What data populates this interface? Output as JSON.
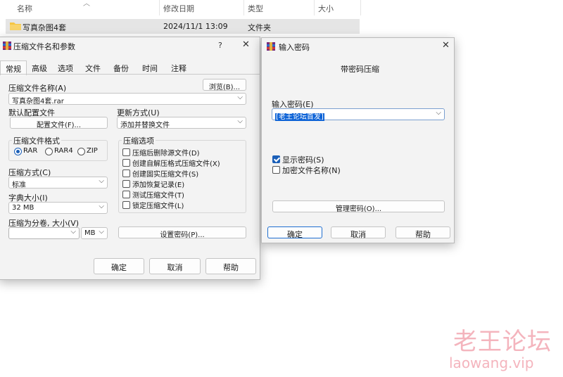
{
  "explorer": {
    "columns": [
      "名称",
      "修改日期",
      "类型",
      "大小"
    ],
    "file": {
      "name": "写真杂图4套",
      "date": "2024/11/1 13:09",
      "type": "文件夹"
    }
  },
  "archive_dialog": {
    "title": "压缩文件名和参数",
    "help_glyph": "?",
    "close_glyph": "✕",
    "tabs": [
      "常规",
      "高级",
      "选项",
      "文件",
      "备份",
      "时间",
      "注释"
    ],
    "archive_name_label": "压缩文件名称(A)",
    "archive_name_value": "写真杂图4套.rar",
    "browse_label": "浏览(B)...",
    "default_profile_label": "默认配置文件",
    "profile_button": "配置文件(F)...",
    "update_method_label": "更新方式(U)",
    "update_method_value": "添加并替换文件",
    "format_group": "压缩文件格式",
    "formats": [
      "RAR",
      "RAR4",
      "ZIP"
    ],
    "compression_method_label": "压缩方式(C)",
    "compression_method_value": "标准",
    "dictionary_label": "字典大小(I)",
    "dictionary_value": "32 MB",
    "split_label": "压缩为分卷, 大小(V)",
    "split_value": "",
    "split_unit": "MB",
    "options_group": "压缩选项",
    "options": [
      "压缩后删除源文件(D)",
      "创建自解压格式压缩文件(X)",
      "创建固实压缩文件(S)",
      "添加恢复记录(E)",
      "测试压缩文件(T)",
      "锁定压缩文件(L)"
    ],
    "set_password_button": "设置密码(P)...",
    "ok": "确定",
    "cancel": "取消",
    "help": "帮助"
  },
  "password_dialog": {
    "title": "输入密码",
    "close_glyph": "✕",
    "heading": "带密码压缩",
    "password_label": "输入密码(E)",
    "password_value": "[老王论坛首发]",
    "show_password": "显示密码(S)",
    "encrypt_names": "加密文件名称(N)",
    "manage_button": "管理密码(O)...",
    "ok": "确定",
    "cancel": "取消",
    "help": "帮助"
  },
  "watermark": {
    "title": "老王论坛",
    "url": "laowang.vip"
  },
  "colors": {
    "accent": "#1b5fb8",
    "selection": "#0c62d6",
    "watermark": "#f4b4bd",
    "folder": "#f5c542"
  }
}
